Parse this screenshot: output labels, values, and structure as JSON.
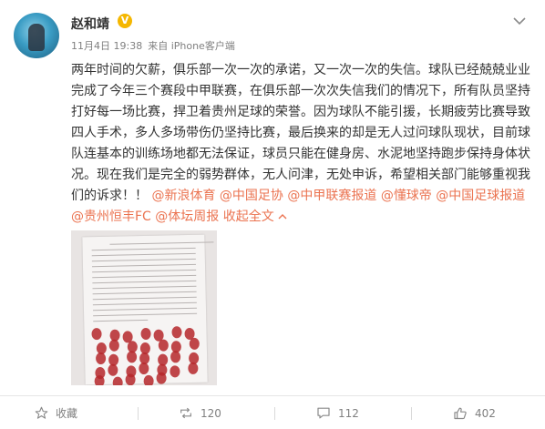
{
  "post": {
    "author": "赵和靖",
    "verified_badge": "V",
    "timestamp": "11月4日 19:38",
    "source": "来自 iPhone客户端",
    "text_main": "两年时间的欠薪，俱乐部一次一次的承诺，又一次一次的失信。球队已经兢兢业业完成了今年三个赛段中甲联赛，在俱乐部一次次失信我们的情况下，所有队员坚持打好每一场比赛，捍卫着贵州足球的荣誉。因为球队不能引援，长期疲劳比赛导致四人手术，多人多场带伤仍坚持比赛，最后换来的却是无人过问球队现状，目前球队连基本的训练场地都无法保证，球员只能在健身房、水泥地坚持跑步保持身体状况。现在我们是完全的弱势群体，无人问津，无处申诉，希望相关部门能够重视我们的诉求！！",
    "mentions": [
      "@新浪体育",
      "@中国足协",
      "@中甲联赛报道",
      "@懂球帝",
      "@中国足球报道",
      "@贵州恒丰FC",
      "@体坛周报"
    ],
    "collapse_label": "收起全文",
    "photo_icon": "petition-document-with-red-fingerprints"
  },
  "actions": {
    "favorite": {
      "label": "收藏",
      "icon": "star-icon"
    },
    "repost": {
      "count": "120",
      "icon": "repost-icon"
    },
    "comment": {
      "count": "112",
      "icon": "comment-icon"
    },
    "like": {
      "count": "402",
      "icon": "thumbs-up-icon"
    }
  },
  "colors": {
    "link": "#eb7350",
    "badge": "#f5b700",
    "muted": "#808080",
    "text": "#333333"
  }
}
